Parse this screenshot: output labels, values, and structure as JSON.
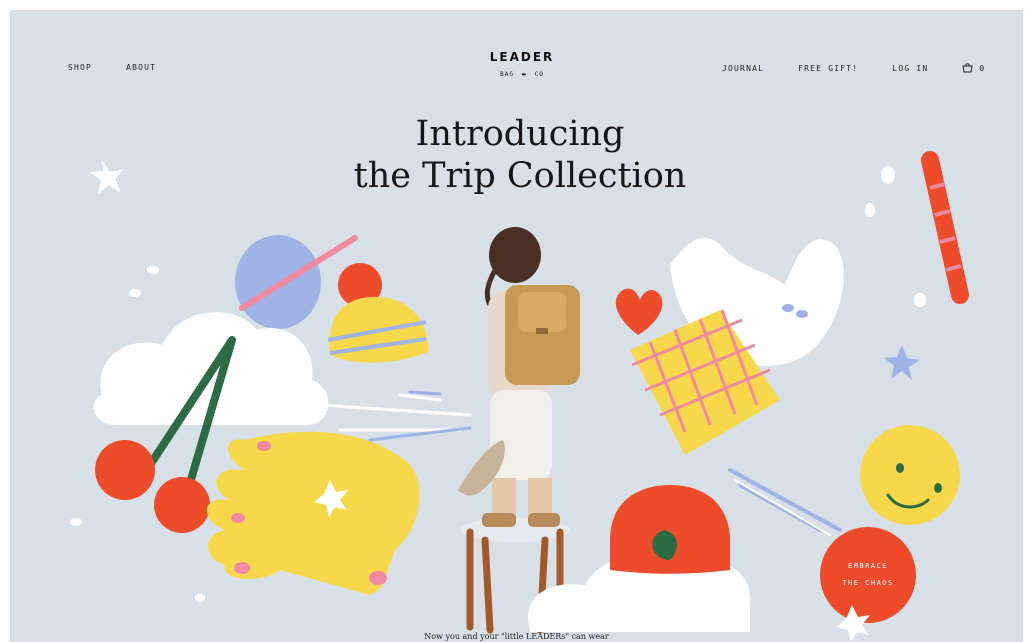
{
  "nav": {
    "left": [
      "SHOP",
      "ABOUT"
    ],
    "right": [
      "JOURNAL",
      "FREE GIFT!",
      "LOG IN"
    ],
    "cart_count": "0"
  },
  "brand": {
    "name": "LEADER",
    "sub_left": "BAG",
    "sub_right": "CO"
  },
  "hero": {
    "line1": "Introducing",
    "line2": "the Trip Collection",
    "badge_line1": "EMBRACE",
    "badge_line2": "THE CHAOS",
    "caption": "Now you and your \"little LEADERs\" can wear"
  },
  "icons": {
    "cart": "shopping-bag-icon"
  },
  "colors": {
    "background": "#d8e0e7",
    "yellow": "#f6d84a",
    "red": "#ee4b2b",
    "pink": "#f08aa0",
    "green": "#2d6b45",
    "blue": "#9fb3e6"
  }
}
